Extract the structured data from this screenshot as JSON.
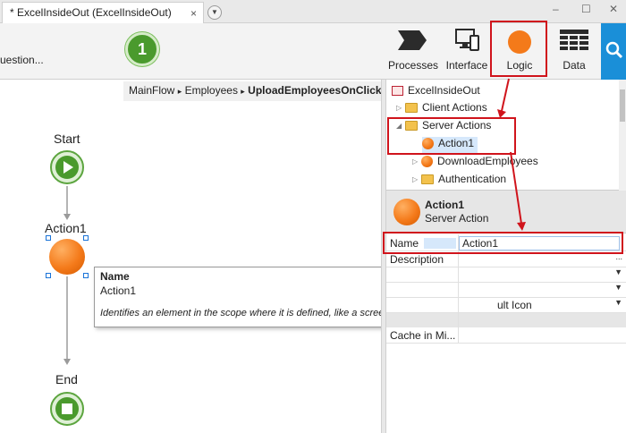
{
  "tab": {
    "title": "* ExcelInsideOut (ExcelInsideOut)",
    "close": "×"
  },
  "window": {
    "minimize": "–",
    "maximize": "☐",
    "close": "✕"
  },
  "toolbar": {
    "left_text": "uestion...",
    "step_badge": "1",
    "processes_label": "Processes",
    "interface_label": "Interface",
    "logic_label": "Logic",
    "data_label": "Data"
  },
  "breadcrumb": {
    "parts": [
      "MainFlow",
      "Employees"
    ],
    "current": "UploadEmployeesOnClick",
    "sep": "▸"
  },
  "flow": {
    "start_label": "Start",
    "action_label": "Action1",
    "end_label": "End"
  },
  "tooltip": {
    "title": "Name",
    "value": "Action1",
    "description": "Identifies an element in the scope where it is defined, like a screen, action, or module."
  },
  "tree": {
    "root": "ExcelInsideOut",
    "client_actions": "Client Actions",
    "server_actions": "Server Actions",
    "action1": "Action1",
    "download_employees": "DownloadEmployees",
    "authentication": "Authentication"
  },
  "properties": {
    "title": "Action1",
    "subtitle": "Server Action",
    "rows": [
      {
        "name": "Name",
        "value": "Action1"
      },
      {
        "name": "Description",
        "value": "..."
      },
      {
        "name": "",
        "value": ""
      },
      {
        "name": "",
        "value": ""
      },
      {
        "name": "",
        "value": "ult Icon"
      },
      {
        "name": "Cache in Mi...",
        "value": ""
      }
    ]
  },
  "colors": {
    "accent_red": "#d0141c",
    "logic_orange": "#f47a1a",
    "flow_green": "#4a9a2d",
    "search_blue": "#1a8fd8"
  }
}
